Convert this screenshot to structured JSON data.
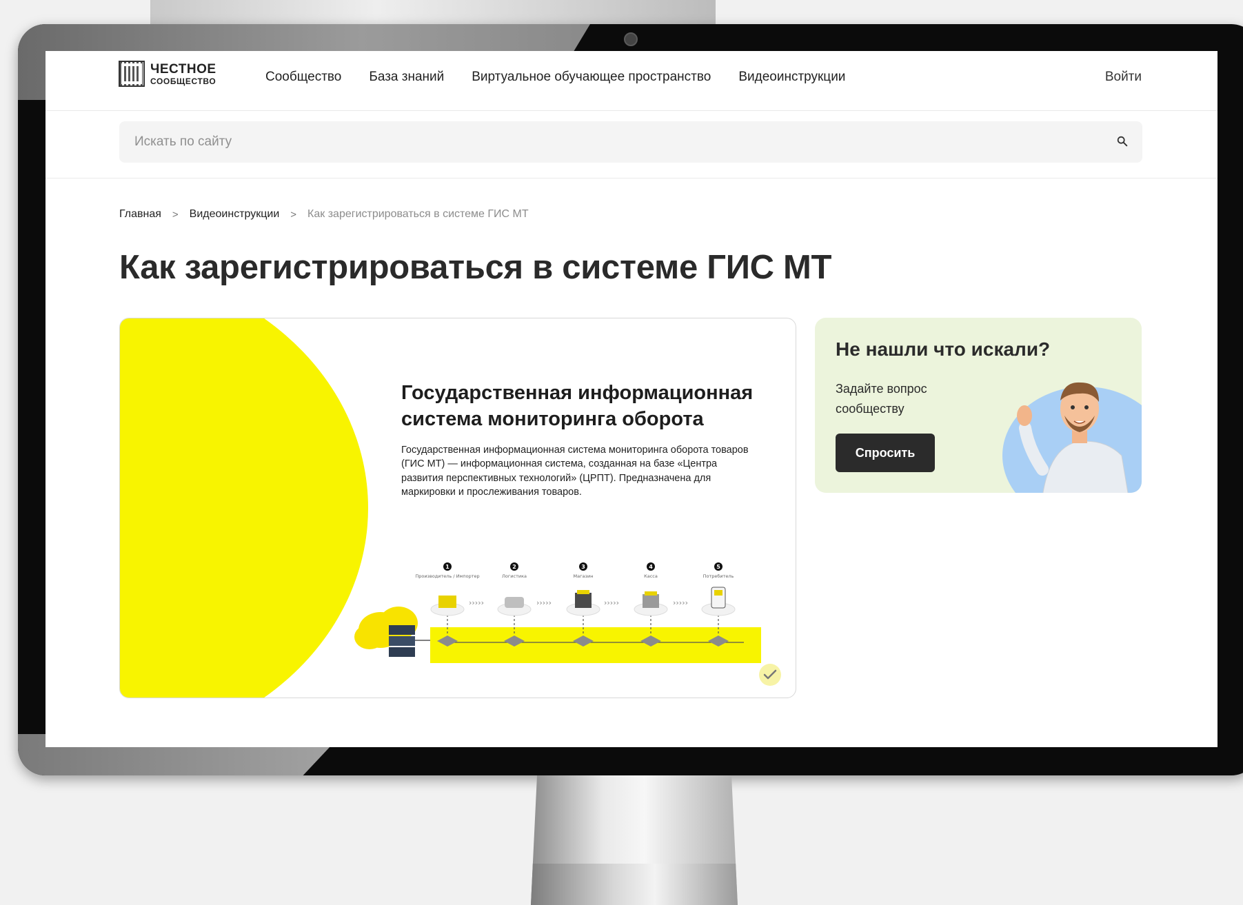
{
  "logo": {
    "line1": "ЧЕСТНОЕ",
    "line2": "СООБЩЕСТВО"
  },
  "nav": [
    {
      "label": "Сообщество"
    },
    {
      "label": "База знаний"
    },
    {
      "label": "Виртуальное обучающее пространство"
    },
    {
      "label": "Видеоинструкции"
    }
  ],
  "header": {
    "login_label": "Войти"
  },
  "search": {
    "placeholder": "Искать по сайту"
  },
  "breadcrumb": {
    "items": [
      "Главная",
      "Видеоинструкции"
    ],
    "current": "Как зарегистрироваться в системе ГИС МТ"
  },
  "page": {
    "title": "Как зарегистрироваться в системе ГИС МТ"
  },
  "video": {
    "title": "Государственная информационная система мониторинга оборота",
    "description": "Государственная информационная система мониторинга оборота товаров (ГИС МТ) — информационная система, созданная на базе «Центра развития перспективных технологий» (ЦРПТ). Предназначена для маркировки и прослеживания товаров.",
    "steps": [
      {
        "num": "1",
        "label": "Производитель / Импортер"
      },
      {
        "num": "2",
        "label": "Логистика"
      },
      {
        "num": "3",
        "label": "Магазин"
      },
      {
        "num": "4",
        "label": "Касса"
      },
      {
        "num": "5",
        "label": "Потребитель"
      }
    ],
    "accent": "#f8f400"
  },
  "ask": {
    "title": "Не нашли что искали?",
    "subtitle": "Задайте вопрос сообществу",
    "button": "Спросить"
  },
  "colors": {
    "button_dark": "#2b2b2b",
    "card_bg": "#ecf4dc"
  }
}
